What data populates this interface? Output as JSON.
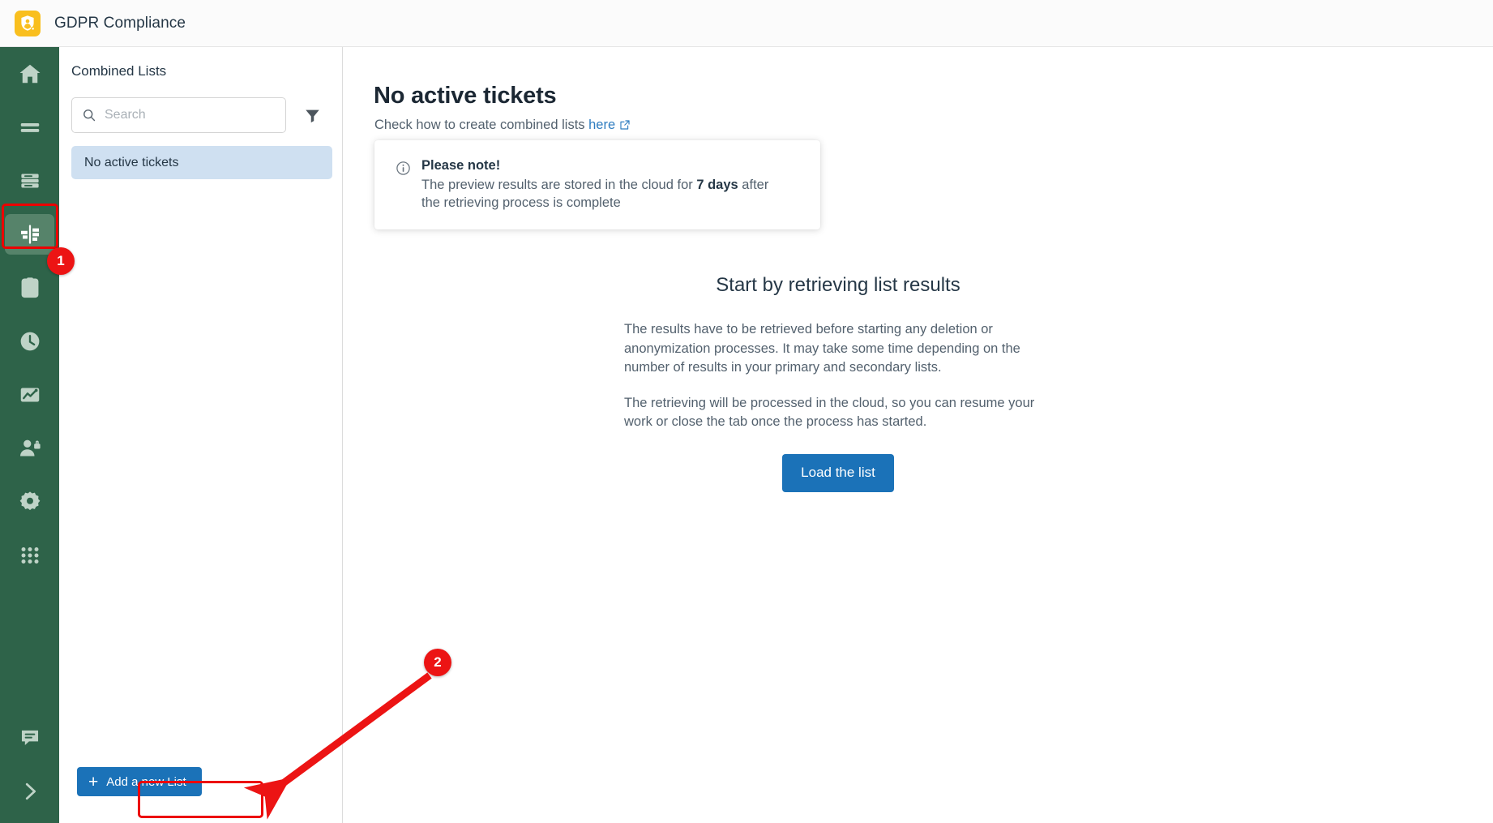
{
  "topbar": {
    "logo_icon": "shield-person-icon",
    "title": "GDPR Compliance"
  },
  "sidebar": {
    "items": [
      {
        "icon": "home-icon",
        "name": "home"
      },
      {
        "icon": "lines-list-icon",
        "name": "lists"
      },
      {
        "icon": "database-icon",
        "name": "data-sources"
      },
      {
        "icon": "combined-lists-icon",
        "name": "combined-lists",
        "selected": true
      },
      {
        "icon": "clipboard-person-icon",
        "name": "requests"
      },
      {
        "icon": "clock-icon",
        "name": "history"
      },
      {
        "icon": "chart-icon",
        "name": "reports"
      },
      {
        "icon": "user-lock-icon",
        "name": "permissions"
      },
      {
        "icon": "gear-icon",
        "name": "settings"
      },
      {
        "icon": "grid-apps-icon",
        "name": "apps"
      }
    ],
    "bottom_items": [
      {
        "icon": "chat-bubble-icon",
        "name": "support-chat"
      },
      {
        "icon": "chevron-right-icon",
        "name": "expand-sidebar"
      }
    ]
  },
  "panel": {
    "title": "Combined Lists",
    "search": {
      "placeholder": "Search",
      "value": "",
      "icon": "search-icon"
    },
    "filter_icon": "filter-funnel-icon",
    "items": [
      {
        "label": "No active tickets",
        "selected": true
      }
    ],
    "add_button": {
      "label": "Add a new List",
      "plus": "+"
    }
  },
  "main": {
    "title": "No active tickets",
    "subtitle_prefix": "Check how to create combined lists ",
    "subtitle_link": "here",
    "external_link_icon": "external-link-icon",
    "note": {
      "icon": "info-circle-icon",
      "heading": "Please note!",
      "text_before": "The preview results are stored in the cloud for ",
      "highlight": "7 days",
      "text_after": " after the retrieving process is complete"
    },
    "hero": {
      "title": "Start by retrieving list results",
      "paragraph1": "The results have to be retrieved before starting any deletion or anonymization processes. It may take some time depending on the number of results in your primary and secondary lists.",
      "paragraph2": "The retrieving will be processed in the cloud, so you can resume your work or close the tab once the process has started.",
      "button_label": "Load the list"
    }
  },
  "annotations": {
    "accent_color": "#ec1414",
    "badges": [
      {
        "number": "1",
        "target": "combined-lists-sidebar-icon"
      },
      {
        "number": "2",
        "target": "add-a-new-list-button"
      }
    ]
  }
}
